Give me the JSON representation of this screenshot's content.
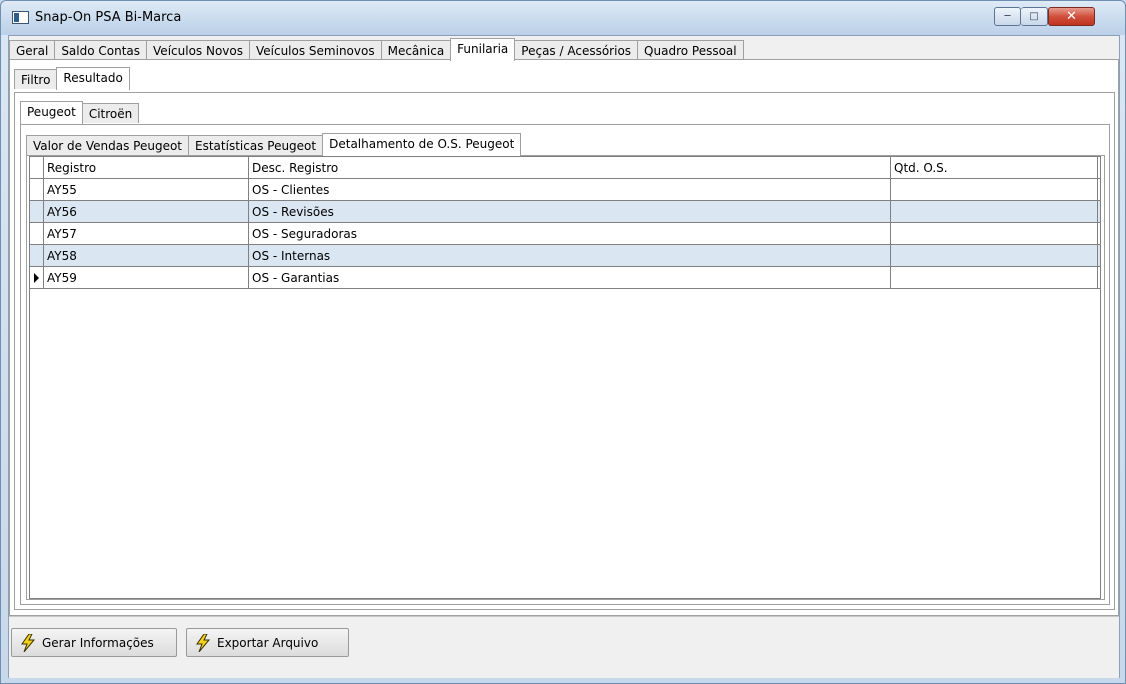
{
  "window": {
    "title": "Snap-On PSA Bi-Marca"
  },
  "main_tabs": [
    "Geral",
    "Saldo Contas",
    "Veículos Novos",
    "Veículos Seminovos",
    "Mecânica",
    "Funilaria",
    "Peças / Acessórios",
    "Quadro Pessoal"
  ],
  "sub_tabs": [
    "Filtro",
    "Resultado"
  ],
  "brand_tabs": [
    "Peugeot",
    "Citroën"
  ],
  "report_tabs": [
    "Valor de Vendas Peugeot",
    "Estatísticas Peugeot",
    "Detalhamento de O.S. Peugeot"
  ],
  "grid": {
    "headers": [
      "Registro",
      "Desc. Registro",
      "Qtd. O.S."
    ],
    "rows": [
      {
        "registro": "AY55",
        "desc": "OS - Clientes",
        "qtd": ""
      },
      {
        "registro": "AY56",
        "desc": "OS - Revisões",
        "qtd": ""
      },
      {
        "registro": "AY57",
        "desc": "OS - Seguradoras",
        "qtd": ""
      },
      {
        "registro": "AY58",
        "desc": "OS - Internas",
        "qtd": ""
      },
      {
        "registro": "AY59",
        "desc": "OS - Garantias",
        "qtd": ""
      }
    ]
  },
  "buttons": {
    "gerar": "Gerar Informações",
    "exportar": "Exportar Arquivo"
  },
  "icons": {
    "button_icon": "lightning-bolt-icon",
    "accent": "#f5d21e",
    "row_alt": "#dae6f2",
    "close": "#c9412d"
  }
}
